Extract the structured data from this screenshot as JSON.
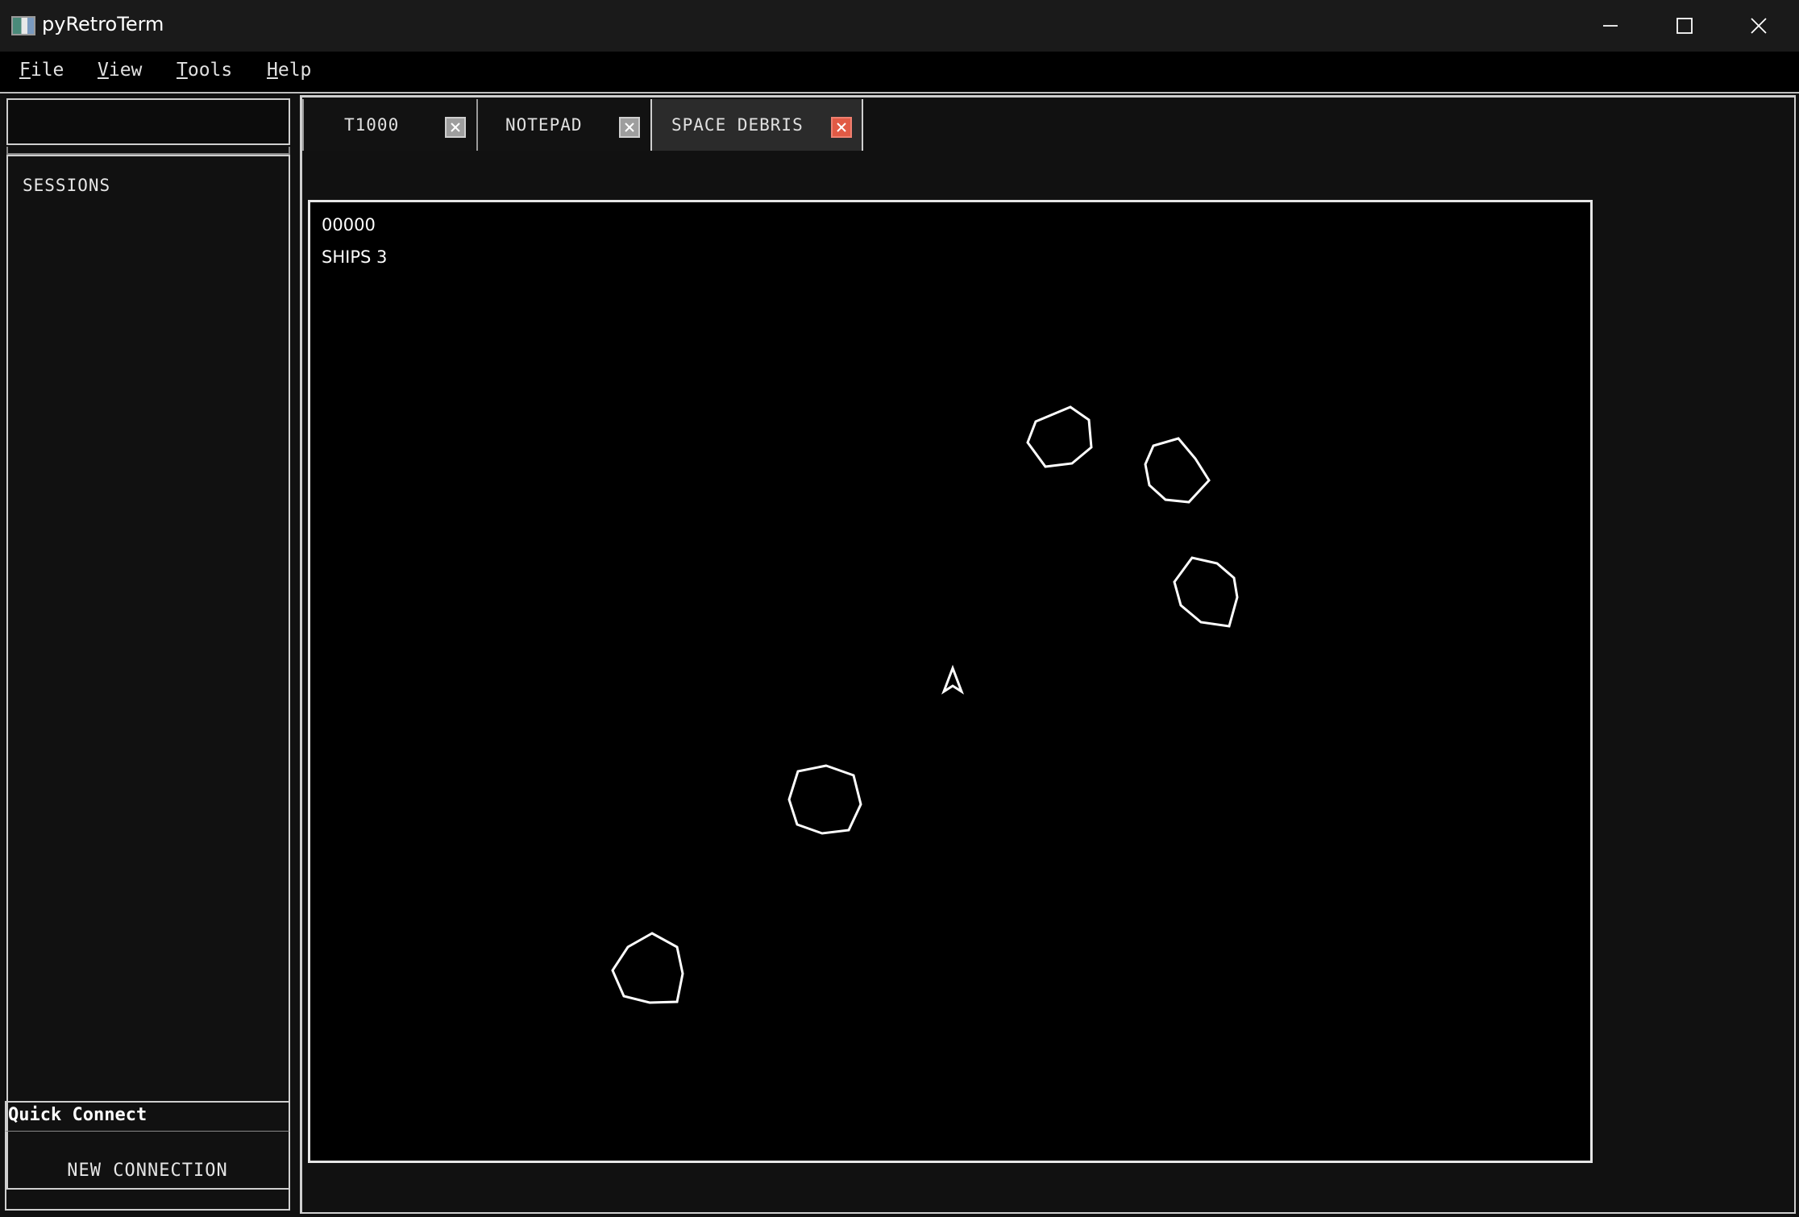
{
  "window": {
    "title": "pyRetroTerm",
    "icons": {
      "app": "app-icon",
      "minimize": "minimize-icon",
      "maximize": "maximize-icon",
      "close": "close-icon"
    }
  },
  "menu": [
    {
      "mnemonic": "F",
      "rest": "ile"
    },
    {
      "mnemonic": "V",
      "rest": "iew"
    },
    {
      "mnemonic": "T",
      "rest": "ools"
    },
    {
      "mnemonic": "H",
      "rest": "elp"
    }
  ],
  "sidebar": {
    "search_value": "",
    "sessions_label": "SESSIONS",
    "quick_connect_label": "Quick Connect",
    "new_connection_label": "NEW CONNECTION"
  },
  "tabs": [
    {
      "label": "T1000",
      "active": false
    },
    {
      "label": "NOTEPAD",
      "active": false
    },
    {
      "label": "SPACE DEBRIS",
      "active": true
    }
  ],
  "colors": {
    "close_active": "#e15a45",
    "close_inactive": "#9e9e9e",
    "border": "#cfcfcf"
  },
  "game": {
    "score": "00000",
    "ships": "SHIPS 3",
    "entities": [
      "ship",
      "asteroid",
      "asteroid",
      "asteroid",
      "asteroid",
      "asteroid"
    ]
  }
}
